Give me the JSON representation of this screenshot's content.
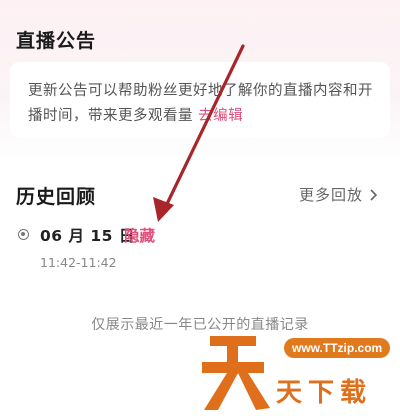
{
  "announcement": {
    "title": "直播公告",
    "text": "更新公告可以帮助粉丝更好地了解你的直播内容和开播时间，带来更多观看量",
    "edit_link": "去编辑"
  },
  "history": {
    "title": "历史回顾",
    "more_label": "更多回放",
    "records": [
      {
        "date": "06 月 15 日",
        "action": "隐藏",
        "time": "11:42-11:42"
      }
    ],
    "footer_note": "仅展示最近一年已公开的直播记录"
  },
  "watermark": {
    "url": "www.TTzip.com",
    "brand": "天下载"
  },
  "colors": {
    "accent_pink": "#e0507a",
    "arrow_red": "#a8262a",
    "watermark_orange": "#e06f1b"
  },
  "icons": [
    "chevron-right-icon",
    "radio-dot-icon",
    "annotation-arrow-icon",
    "watermark-logo-icon"
  ]
}
